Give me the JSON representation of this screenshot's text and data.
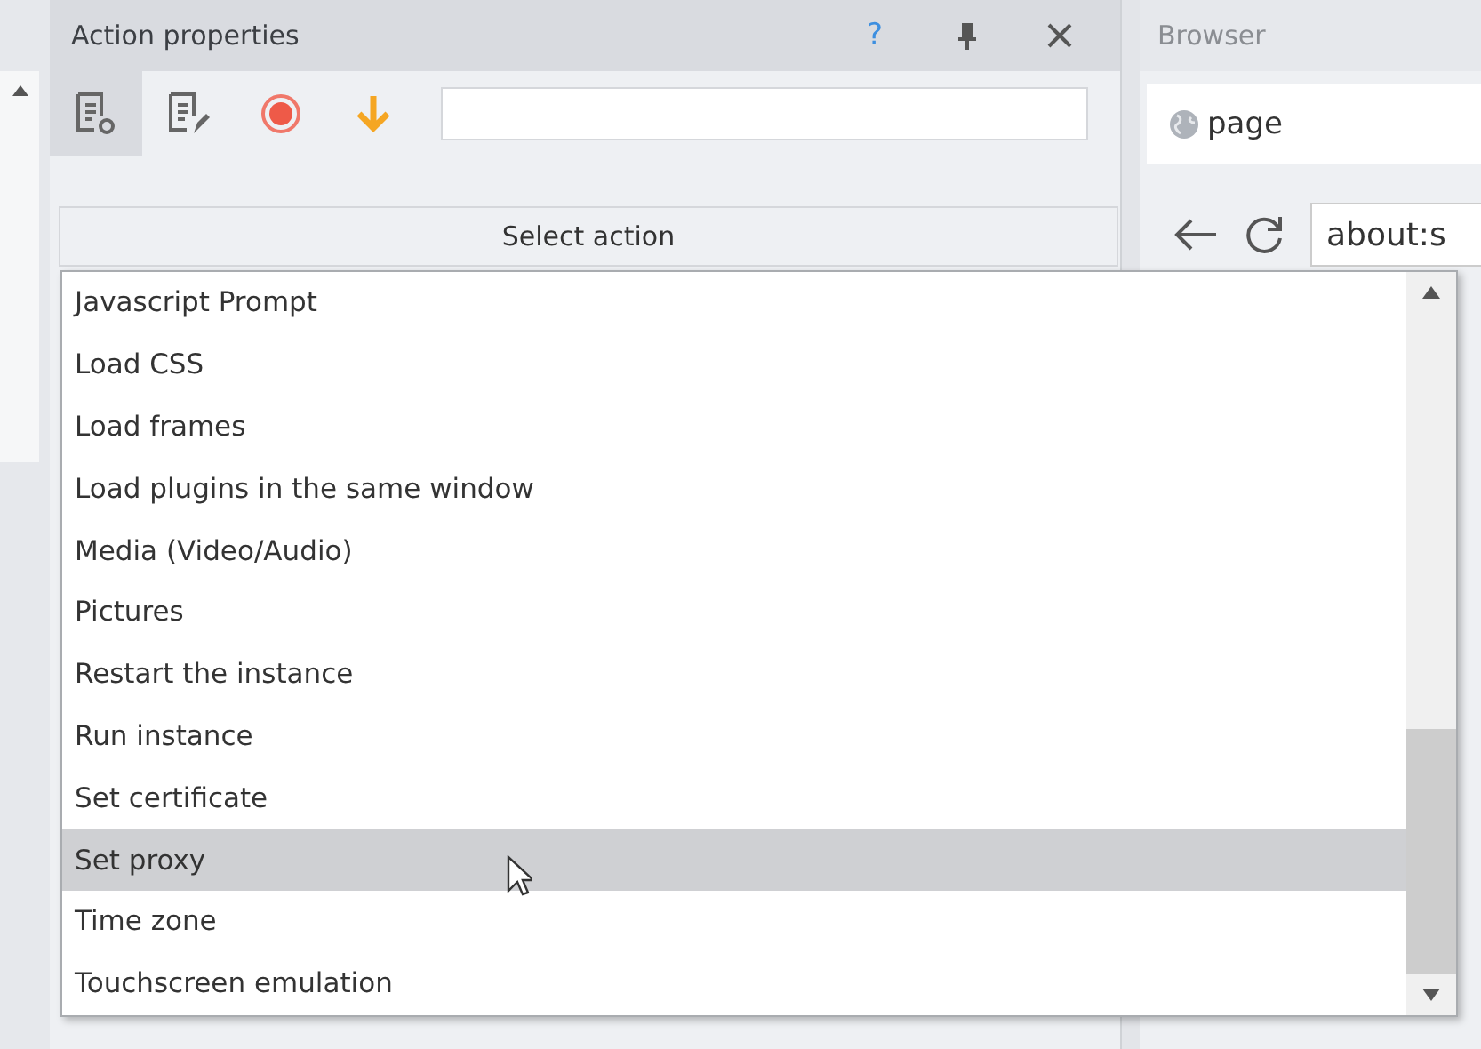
{
  "panel": {
    "title": "Action properties",
    "help": "?",
    "select_label": "Select action"
  },
  "browser": {
    "title": "Browser",
    "tab": "page",
    "address": "about:s"
  },
  "dropdown": {
    "items": [
      {
        "label": "Javascript Prompt",
        "selected": false
      },
      {
        "label": "Load CSS",
        "selected": false
      },
      {
        "label": "Load frames",
        "selected": false
      },
      {
        "label": "Load plugins in the same window",
        "selected": false
      },
      {
        "label": "Media (Video/Audio)",
        "selected": false
      },
      {
        "label": "Pictures",
        "selected": false
      },
      {
        "label": "Restart the instance",
        "selected": false
      },
      {
        "label": "Run instance",
        "selected": false
      },
      {
        "label": "Set certificate",
        "selected": false
      },
      {
        "label": "Set proxy",
        "selected": true
      },
      {
        "label": "Time zone",
        "selected": false
      },
      {
        "label": "Touchscreen emulation",
        "selected": false
      }
    ]
  }
}
